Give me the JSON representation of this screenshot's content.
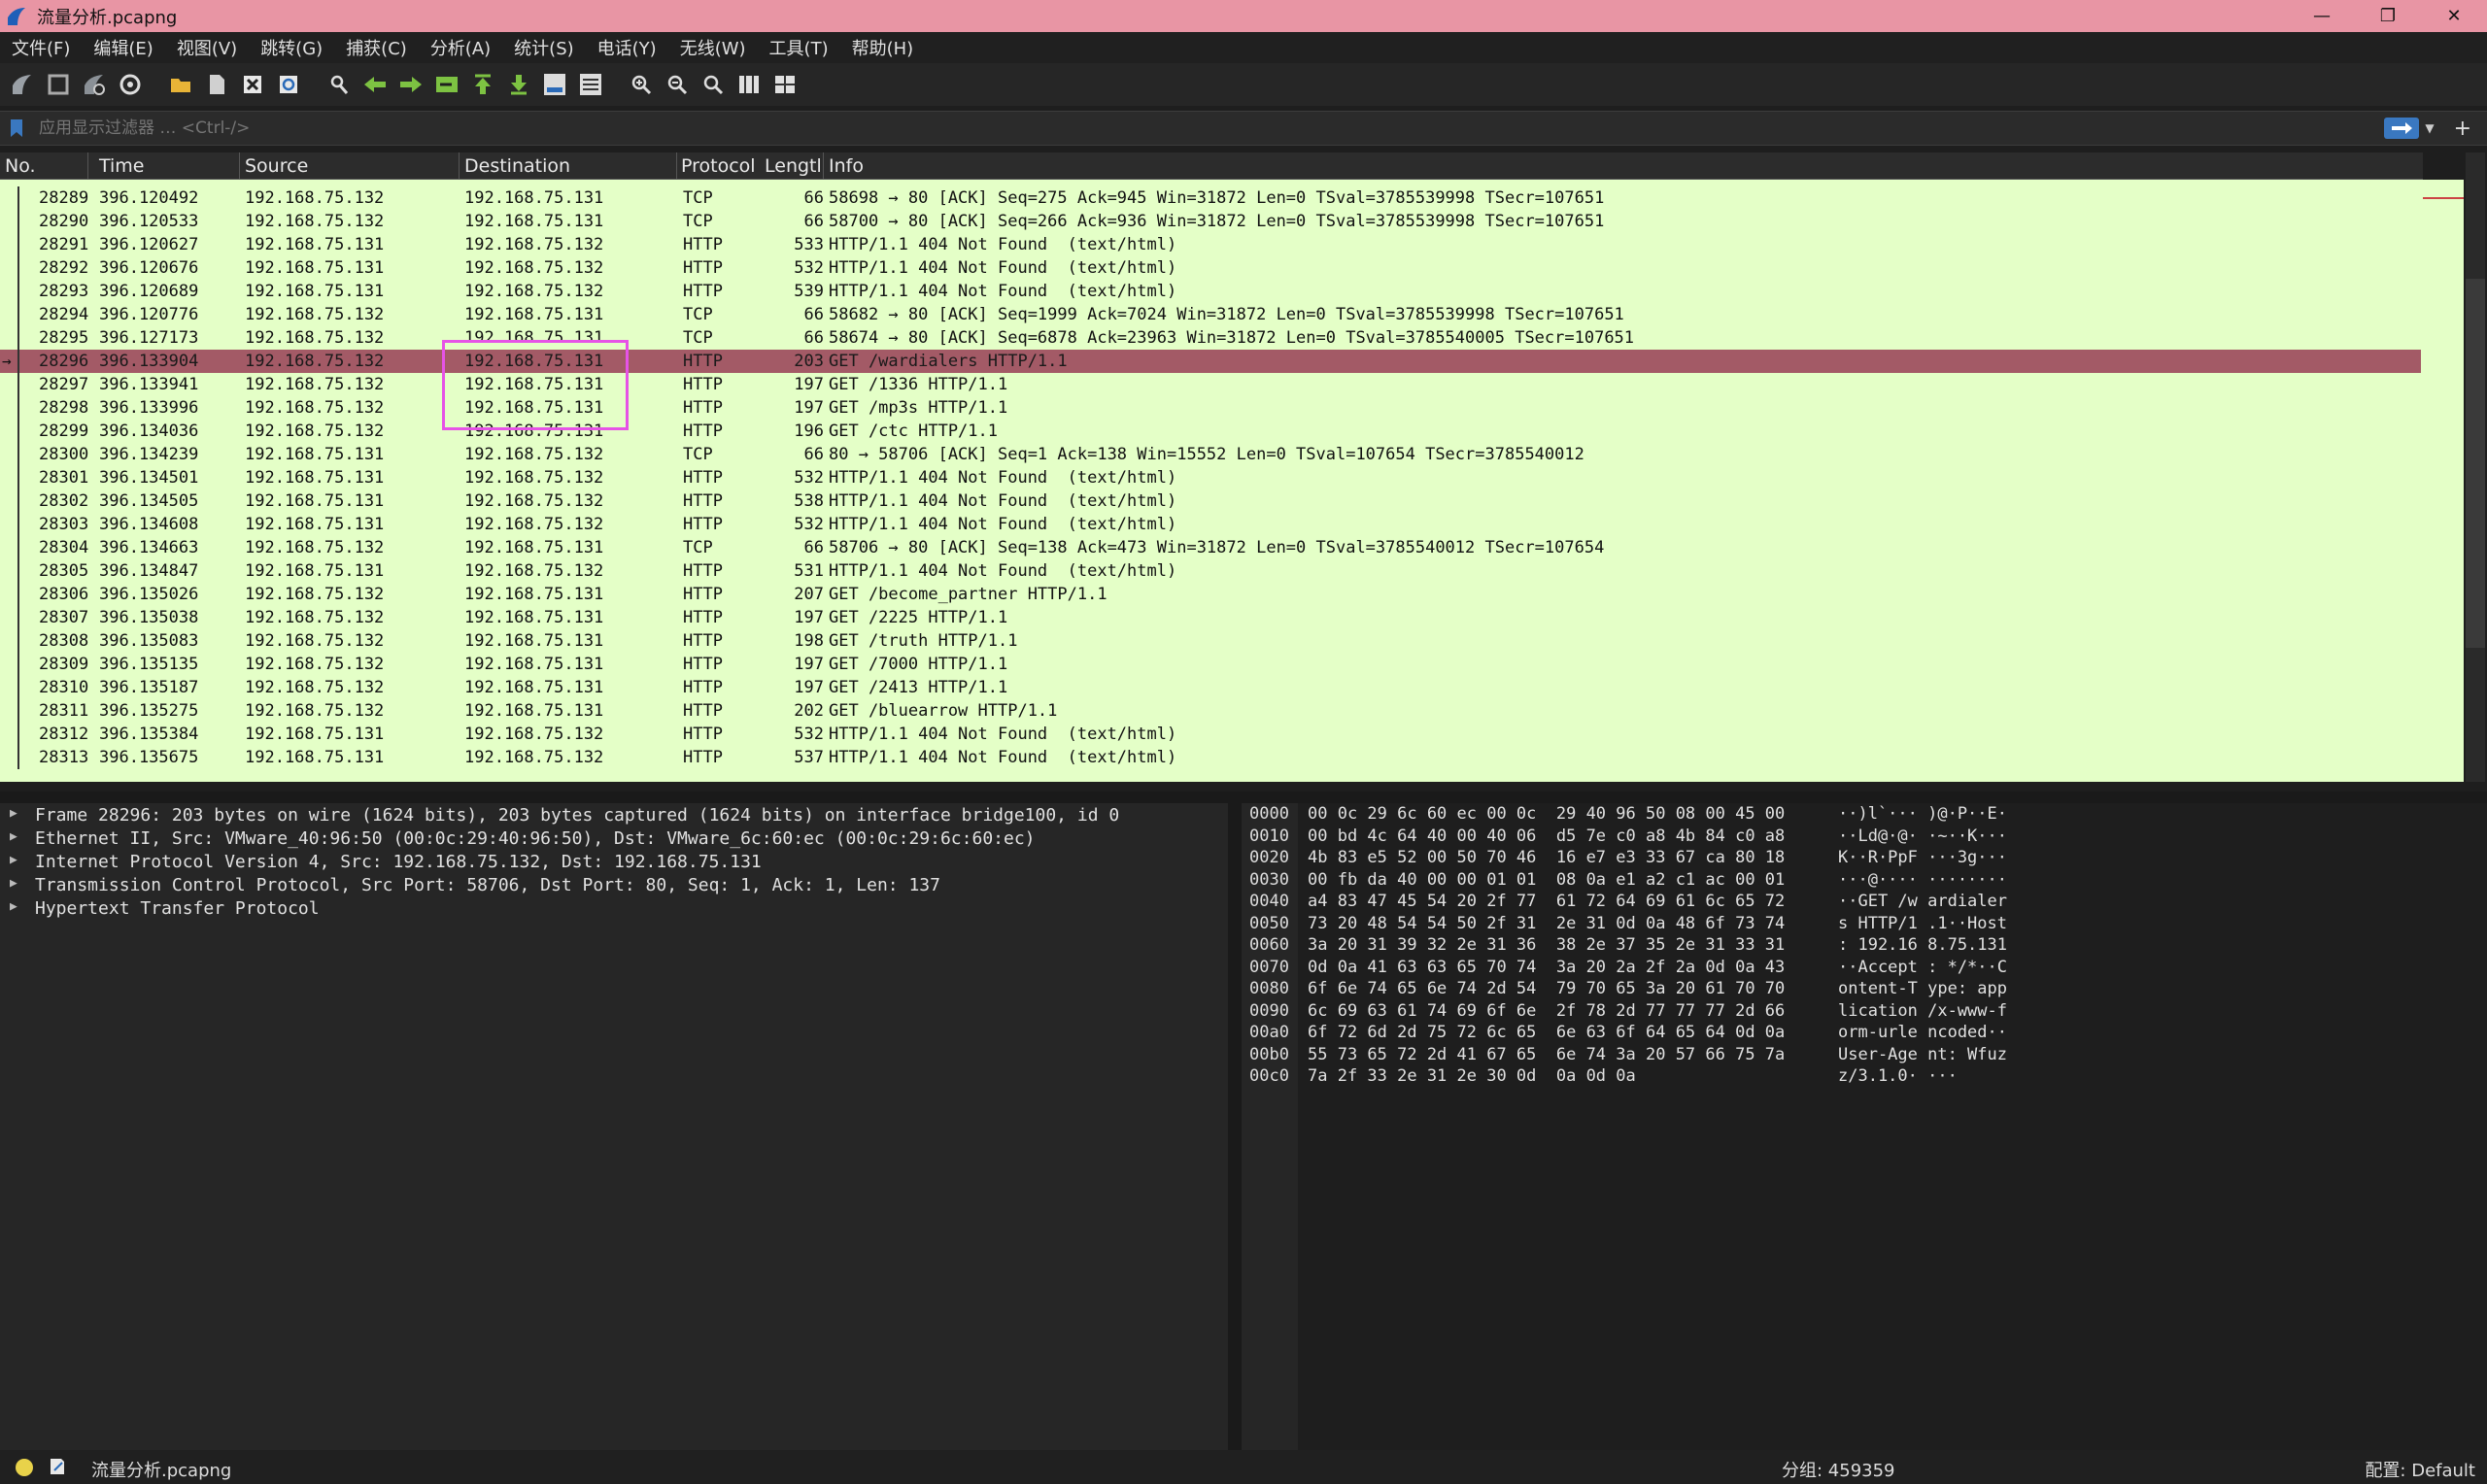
{
  "window": {
    "title": "流量分析.pcapng",
    "controls": [
      "—",
      "❐",
      "✕"
    ]
  },
  "menu": [
    "文件(F)",
    "编辑(E)",
    "视图(V)",
    "跳转(G)",
    "捕获(C)",
    "分析(A)",
    "统计(S)",
    "电话(Y)",
    "无线(W)",
    "工具(T)",
    "帮助(H)"
  ],
  "toolbar": {
    "icons": [
      "shark-fin-start-icon",
      "stop-square-icon",
      "shark-fin-restart-icon",
      "capture-options-gear-icon",
      "open-folder-icon",
      "file-icon",
      "close-file-icon",
      "reload-icon",
      "find-magnifier-icon",
      "go-back-arrow-icon",
      "go-forward-arrow-icon",
      "go-to-packet-icon",
      "first-packet-icon",
      "last-packet-icon",
      "auto-scroll-icon",
      "colorize-icon",
      "zoom-in-icon",
      "zoom-out-icon",
      "normal-size-icon",
      "resize-columns-icon",
      "layout-grid-icon"
    ]
  },
  "filter": {
    "placeholder": "应用显示过滤器 … <Ctrl-/>",
    "plus": "+"
  },
  "packet_list": {
    "columns": [
      "No.",
      "Time",
      "Source",
      "Destination",
      "Protocol",
      "Lengtl",
      "Info"
    ],
    "rows": [
      {
        "no": "28289",
        "time": "396.120492",
        "src": "192.168.75.132",
        "dst": "192.168.75.131",
        "proto": "TCP",
        "len": "66",
        "info": "58698 → 80 [ACK] Seq=275 Ack=945 Win=31872 Len=0 TSval=3785539998 TSecr=107651"
      },
      {
        "no": "28290",
        "time": "396.120533",
        "src": "192.168.75.132",
        "dst": "192.168.75.131",
        "proto": "TCP",
        "len": "66",
        "info": "58700 → 80 [ACK] Seq=266 Ack=936 Win=31872 Len=0 TSval=3785539998 TSecr=107651"
      },
      {
        "no": "28291",
        "time": "396.120627",
        "src": "192.168.75.131",
        "dst": "192.168.75.132",
        "proto": "HTTP",
        "len": "533",
        "info": "HTTP/1.1 404 Not Found  (text/html)"
      },
      {
        "no": "28292",
        "time": "396.120676",
        "src": "192.168.75.131",
        "dst": "192.168.75.132",
        "proto": "HTTP",
        "len": "532",
        "info": "HTTP/1.1 404 Not Found  (text/html)"
      },
      {
        "no": "28293",
        "time": "396.120689",
        "src": "192.168.75.131",
        "dst": "192.168.75.132",
        "proto": "HTTP",
        "len": "539",
        "info": "HTTP/1.1 404 Not Found  (text/html)"
      },
      {
        "no": "28294",
        "time": "396.120776",
        "src": "192.168.75.132",
        "dst": "192.168.75.131",
        "proto": "TCP",
        "len": "66",
        "info": "58682 → 80 [ACK] Seq=1999 Ack=7024 Win=31872 Len=0 TSval=3785539998 TSecr=107651"
      },
      {
        "no": "28295",
        "time": "396.127173",
        "src": "192.168.75.132",
        "dst": "192.168.75.131",
        "proto": "TCP",
        "len": "66",
        "info": "58674 → 80 [ACK] Seq=6878 Ack=23963 Win=31872 Len=0 TSval=3785540005 TSecr=107651"
      },
      {
        "no": "28296",
        "time": "396.133904",
        "src": "192.168.75.132",
        "dst": "192.168.75.131",
        "proto": "HTTP",
        "len": "203",
        "info": "GET /wardialers HTTP/1.1"
      },
      {
        "no": "28297",
        "time": "396.133941",
        "src": "192.168.75.132",
        "dst": "192.168.75.131",
        "proto": "HTTP",
        "len": "197",
        "info": "GET /1336 HTTP/1.1"
      },
      {
        "no": "28298",
        "time": "396.133996",
        "src": "192.168.75.132",
        "dst": "192.168.75.131",
        "proto": "HTTP",
        "len": "197",
        "info": "GET /mp3s HTTP/1.1"
      },
      {
        "no": "28299",
        "time": "396.134036",
        "src": "192.168.75.132",
        "dst": "192.168.75.131",
        "proto": "HTTP",
        "len": "196",
        "info": "GET /ctc HTTP/1.1"
      },
      {
        "no": "28300",
        "time": "396.134239",
        "src": "192.168.75.131",
        "dst": "192.168.75.132",
        "proto": "TCP",
        "len": "66",
        "info": "80 → 58706 [ACK] Seq=1 Ack=138 Win=15552 Len=0 TSval=107654 TSecr=3785540012"
      },
      {
        "no": "28301",
        "time": "396.134501",
        "src": "192.168.75.131",
        "dst": "192.168.75.132",
        "proto": "HTTP",
        "len": "532",
        "info": "HTTP/1.1 404 Not Found  (text/html)"
      },
      {
        "no": "28302",
        "time": "396.134505",
        "src": "192.168.75.131",
        "dst": "192.168.75.132",
        "proto": "HTTP",
        "len": "538",
        "info": "HTTP/1.1 404 Not Found  (text/html)"
      },
      {
        "no": "28303",
        "time": "396.134608",
        "src": "192.168.75.131",
        "dst": "192.168.75.132",
        "proto": "HTTP",
        "len": "532",
        "info": "HTTP/1.1 404 Not Found  (text/html)"
      },
      {
        "no": "28304",
        "time": "396.134663",
        "src": "192.168.75.132",
        "dst": "192.168.75.131",
        "proto": "TCP",
        "len": "66",
        "info": "58706 → 80 [ACK] Seq=138 Ack=473 Win=31872 Len=0 TSval=3785540012 TSecr=107654"
      },
      {
        "no": "28305",
        "time": "396.134847",
        "src": "192.168.75.131",
        "dst": "192.168.75.132",
        "proto": "HTTP",
        "len": "531",
        "info": "HTTP/1.1 404 Not Found  (text/html)"
      },
      {
        "no": "28306",
        "time": "396.135026",
        "src": "192.168.75.132",
        "dst": "192.168.75.131",
        "proto": "HTTP",
        "len": "207",
        "info": "GET /become_partner HTTP/1.1"
      },
      {
        "no": "28307",
        "time": "396.135038",
        "src": "192.168.75.132",
        "dst": "192.168.75.131",
        "proto": "HTTP",
        "len": "197",
        "info": "GET /2225 HTTP/1.1"
      },
      {
        "no": "28308",
        "time": "396.135083",
        "src": "192.168.75.132",
        "dst": "192.168.75.131",
        "proto": "HTTP",
        "len": "198",
        "info": "GET /truth HTTP/1.1"
      },
      {
        "no": "28309",
        "time": "396.135135",
        "src": "192.168.75.132",
        "dst": "192.168.75.131",
        "proto": "HTTP",
        "len": "197",
        "info": "GET /7000 HTTP/1.1"
      },
      {
        "no": "28310",
        "time": "396.135187",
        "src": "192.168.75.132",
        "dst": "192.168.75.131",
        "proto": "HTTP",
        "len": "197",
        "info": "GET /2413 HTTP/1.1"
      },
      {
        "no": "28311",
        "time": "396.135275",
        "src": "192.168.75.132",
        "dst": "192.168.75.131",
        "proto": "HTTP",
        "len": "202",
        "info": "GET /bluearrow HTTP/1.1"
      },
      {
        "no": "28312",
        "time": "396.135384",
        "src": "192.168.75.131",
        "dst": "192.168.75.132",
        "proto": "HTTP",
        "len": "532",
        "info": "HTTP/1.1 404 Not Found  (text/html)"
      },
      {
        "no": "28313",
        "time": "396.135675",
        "src": "192.168.75.131",
        "dst": "192.168.75.132",
        "proto": "HTTP",
        "len": "537",
        "info": "HTTP/1.1 404 Not Found  (text/html)"
      }
    ],
    "selected_no": "28296"
  },
  "details": [
    "Frame 28296: 203 bytes on wire (1624 bits), 203 bytes captured (1624 bits) on interface bridge100, id 0",
    "Ethernet II, Src: VMware_40:96:50 (00:0c:29:40:96:50), Dst: VMware_6c:60:ec (00:0c:29:6c:60:ec)",
    "Internet Protocol Version 4, Src: 192.168.75.132, Dst: 192.168.75.131",
    "Transmission Control Protocol, Src Port: 58706, Dst Port: 80, Seq: 1, Ack: 1, Len: 137",
    "Hypertext Transfer Protocol"
  ],
  "hex": [
    {
      "off": "0000",
      "bytes": "00 0c 29 6c 60 ec 00 0c  29 40 96 50 08 00 45 00",
      "ascii": "··)l`··· )@·P··E·"
    },
    {
      "off": "0010",
      "bytes": "00 bd 4c 64 40 00 40 06  d5 7e c0 a8 4b 84 c0 a8",
      "ascii": "··Ld@·@· ·~··K···"
    },
    {
      "off": "0020",
      "bytes": "4b 83 e5 52 00 50 70 46  16 e7 e3 33 67 ca 80 18",
      "ascii": "K··R·PpF ···3g···"
    },
    {
      "off": "0030",
      "bytes": "00 fb da 40 00 00 01 01  08 0a e1 a2 c1 ac 00 01",
      "ascii": "···@···· ········"
    },
    {
      "off": "0040",
      "bytes": "a4 83 47 45 54 20 2f 77  61 72 64 69 61 6c 65 72",
      "ascii": "··GET /w ardialer"
    },
    {
      "off": "0050",
      "bytes": "73 20 48 54 54 50 2f 31  2e 31 0d 0a 48 6f 73 74",
      "ascii": "s HTTP/1 .1··Host"
    },
    {
      "off": "0060",
      "bytes": "3a 20 31 39 32 2e 31 36  38 2e 37 35 2e 31 33 31",
      "ascii": ": 192.16 8.75.131"
    },
    {
      "off": "0070",
      "bytes": "0d 0a 41 63 63 65 70 74  3a 20 2a 2f 2a 0d 0a 43",
      "ascii": "··Accept : */*··C"
    },
    {
      "off": "0080",
      "bytes": "6f 6e 74 65 6e 74 2d 54  79 70 65 3a 20 61 70 70",
      "ascii": "ontent-T ype: app"
    },
    {
      "off": "0090",
      "bytes": "6c 69 63 61 74 69 6f 6e  2f 78 2d 77 77 77 2d 66",
      "ascii": "lication /x-www-f"
    },
    {
      "off": "00a0",
      "bytes": "6f 72 6d 2d 75 72 6c 65  6e 63 6f 64 65 64 0d 0a",
      "ascii": "orm-urle ncoded··"
    },
    {
      "off": "00b0",
      "bytes": "55 73 65 72 2d 41 67 65  6e 74 3a 20 57 66 75 7a",
      "ascii": "User-Age nt: Wfuz"
    },
    {
      "off": "00c0",
      "bytes": "7a 2f 33 2e 31 2e 30 0d  0a 0d 0a",
      "ascii": "z/3.1.0· ···"
    }
  ],
  "status": {
    "file": "流量分析.pcapng",
    "packets": "分组: 459359",
    "profile": "配置: Default"
  },
  "colors": {
    "titlebar": "#e895a4",
    "row_bg": "#e4ffc7",
    "selected_row": "#a35a66",
    "highlight_box": "#e653e6"
  }
}
